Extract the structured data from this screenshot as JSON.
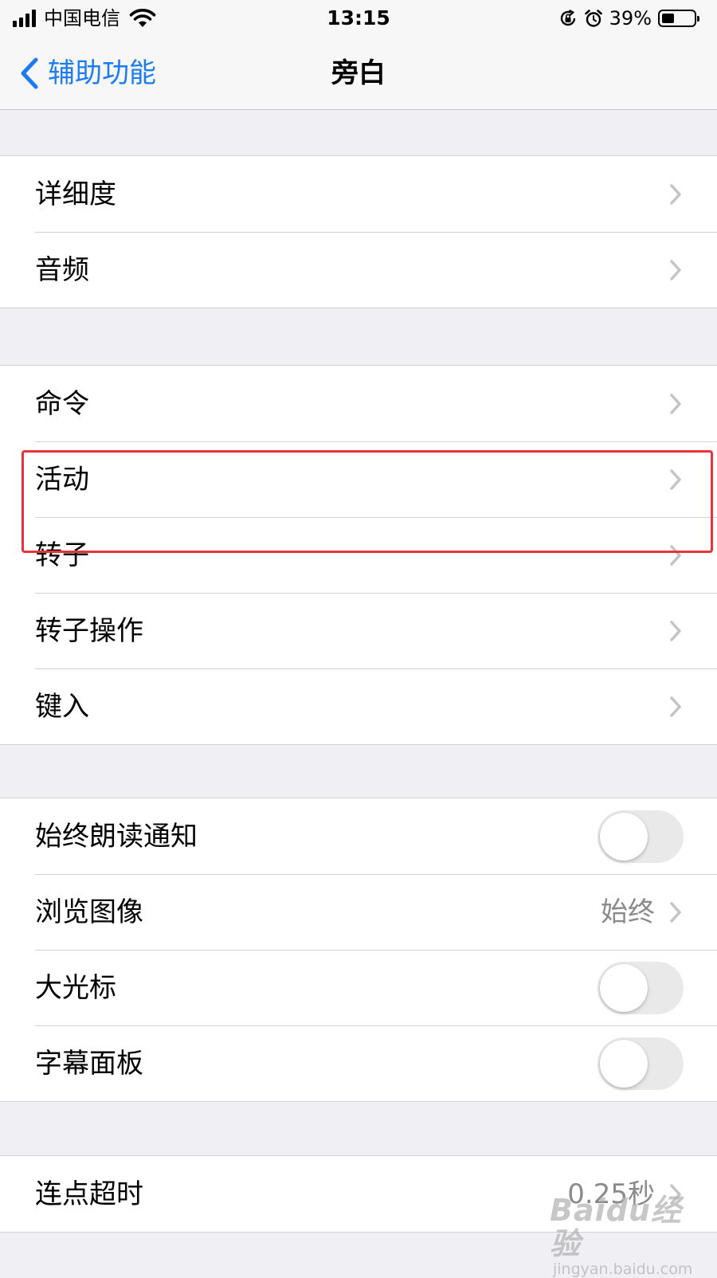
{
  "status_bar": {
    "carrier": "中国电信",
    "time": "13:15",
    "battery_percent": "39%",
    "battery_level": 0.39
  },
  "nav": {
    "back_label": "辅助功能",
    "title": "旁白"
  },
  "groups": [
    {
      "rows": [
        {
          "label": "详细度"
        },
        {
          "label": "音频"
        }
      ]
    },
    {
      "rows": [
        {
          "label": "命令"
        },
        {
          "label": "活动"
        },
        {
          "label": "转子"
        },
        {
          "label": "转子操作"
        },
        {
          "label": "键入"
        }
      ]
    },
    {
      "rows": [
        {
          "label": "始终朗读通知",
          "toggle_on": false
        },
        {
          "label": "浏览图像",
          "value": "始终"
        },
        {
          "label": "大光标",
          "toggle_on": false
        },
        {
          "label": "字幕面板",
          "toggle_on": false
        }
      ]
    },
    {
      "rows": [
        {
          "label": "连点超时",
          "value": "0.25秒"
        }
      ]
    }
  ],
  "watermark": {
    "logo": "Baidu经验",
    "url": "jingyan.baidu.com"
  },
  "colors": {
    "accent": "#1a7cf0",
    "highlight": "#e8333a",
    "background": "#efeff4"
  }
}
